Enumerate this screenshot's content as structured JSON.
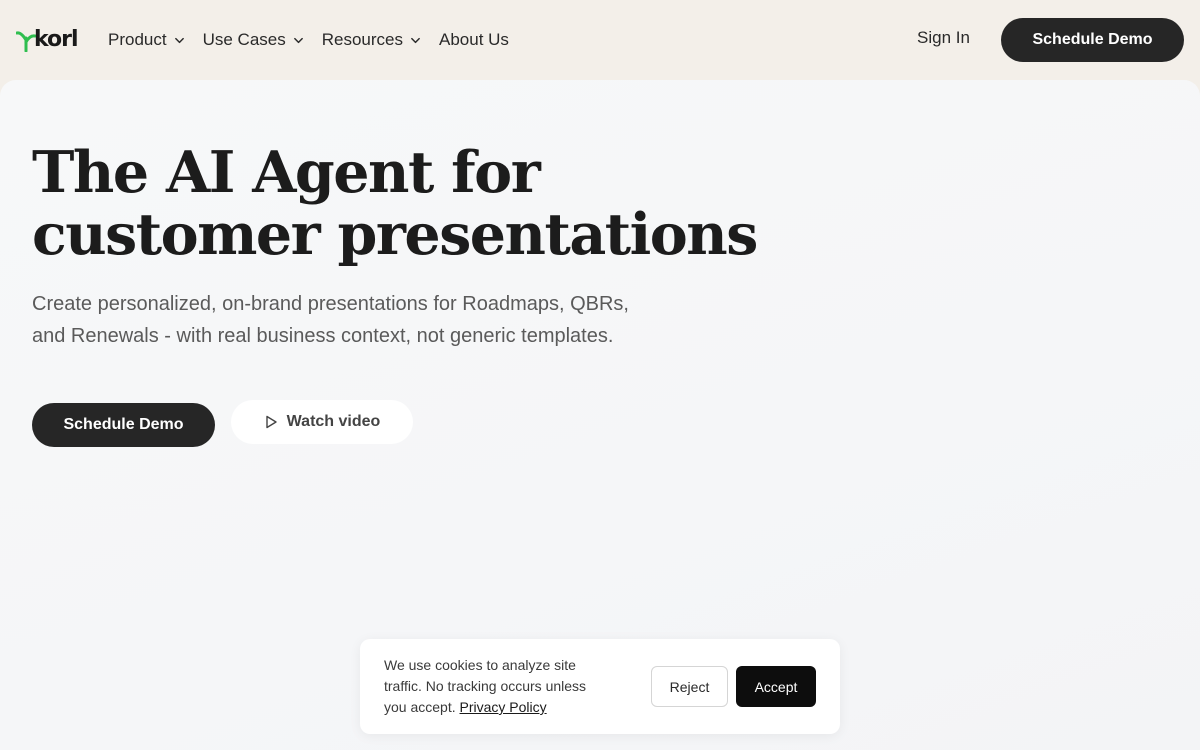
{
  "header": {
    "logo_text": "korl",
    "nav": [
      {
        "label": "Product",
        "has_dropdown": true
      },
      {
        "label": "Use Cases",
        "has_dropdown": true
      },
      {
        "label": "Resources",
        "has_dropdown": true
      },
      {
        "label": "About Us",
        "has_dropdown": false
      }
    ],
    "sign_in_label": "Sign In",
    "schedule_demo_label": "Schedule Demo"
  },
  "hero": {
    "headline_line1": "The AI Agent for",
    "headline_line2": "customer presentations",
    "subhead_line1": "Create personalized, on-brand presentations for Roadmaps, QBRs,",
    "subhead_line2": "and Renewals - with real business context, not generic templates.",
    "primary_cta_label": "Schedule Demo",
    "secondary_cta_label": "Watch video",
    "secondary_cta_icon": "play-icon"
  },
  "cookie_banner": {
    "line1": "We use cookies to analyze site",
    "line2": "traffic. No tracking occurs unless",
    "line3_prefix": "you accept.",
    "privacy_link": "Privacy Policy",
    "reject_label": "Reject",
    "accept_label": "Accept"
  },
  "colors": {
    "header_bg": "#f3efe9",
    "hero_bg": "#f6f7f9",
    "primary_button": "#262626",
    "logo_accent": "#2fbe4f",
    "accept_button": "#0d0d0d"
  }
}
